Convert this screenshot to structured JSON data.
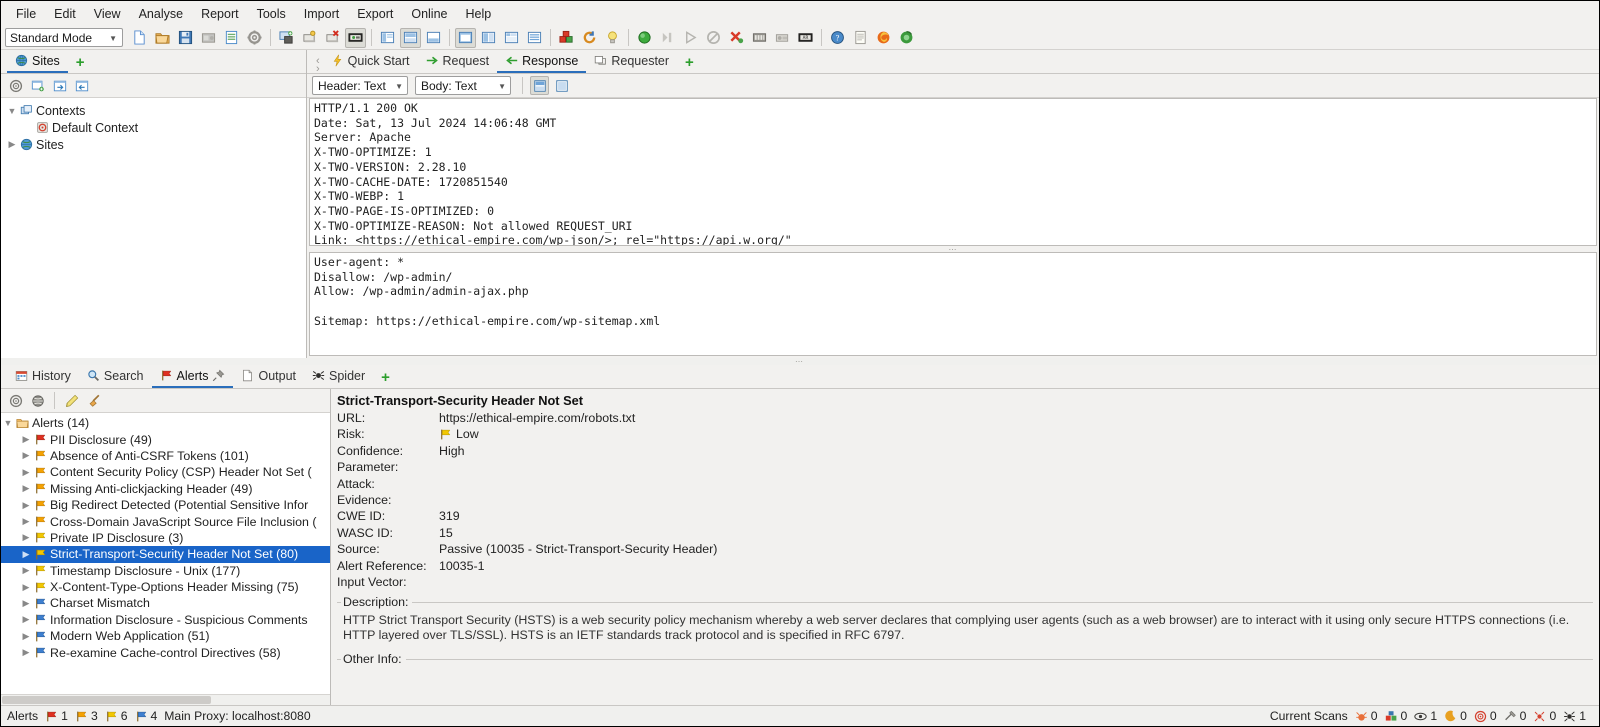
{
  "menubar": {
    "items": [
      "File",
      "Edit",
      "View",
      "Analyse",
      "Report",
      "Tools",
      "Import",
      "Export",
      "Online",
      "Help"
    ]
  },
  "toolbar": {
    "mode": "Standard Mode",
    "buttons": [
      {
        "name": "new-session-icon",
        "title": "New Session"
      },
      {
        "name": "open-session-icon",
        "title": "Open Session"
      },
      {
        "name": "save-session-icon",
        "title": "Persist Session"
      },
      {
        "name": "snapshot-session-icon",
        "title": "Snapshot Session"
      },
      {
        "name": "session-properties-icon",
        "title": "Session Properties"
      },
      {
        "name": "options-gear-icon",
        "title": "Options"
      },
      {
        "name": "manage-addons-icon",
        "title": "Manage Add-ons"
      },
      {
        "name": "expand-panel-icon",
        "title": "Expand"
      },
      {
        "name": "close-panel-icon",
        "title": "Close"
      },
      {
        "name": "full-layout-icon",
        "title": "Full Layout"
      },
      {
        "name": "layout-left-icon",
        "title": "Layout Left"
      },
      {
        "name": "layout-split-icon",
        "title": "Layout Split"
      },
      {
        "name": "layout-bottom-icon",
        "title": "Layout Bottom"
      },
      {
        "name": "layout-expand-icon",
        "title": "Expand Layout"
      },
      {
        "name": "layout-columns-icon",
        "title": "Columns Layout"
      },
      {
        "name": "layout-tabs-icon",
        "title": "Tabs Layout"
      },
      {
        "name": "layout-list-icon",
        "title": "List Layout"
      },
      {
        "name": "scan-policy-icon",
        "title": "Scan Policy Manager"
      },
      {
        "name": "refresh-icon",
        "title": "Refresh"
      },
      {
        "name": "lightbulb-icon",
        "title": "Show Tips"
      },
      {
        "name": "record-green-icon",
        "title": "Set Break"
      },
      {
        "name": "step-icon",
        "title": "Step"
      },
      {
        "name": "continue-icon",
        "title": "Continue"
      },
      {
        "name": "drop-icon",
        "title": "Drop"
      },
      {
        "name": "break-off-icon",
        "title": "Break Off"
      },
      {
        "name": "request-break-icon",
        "title": "Break on Request"
      },
      {
        "name": "response-break-icon",
        "title": "Break on Response"
      },
      {
        "name": "all-requests-icon",
        "title": "All Requests"
      },
      {
        "name": "help-circle-icon",
        "title": "Help"
      },
      {
        "name": "report-icon",
        "title": "Report"
      },
      {
        "name": "firefox-browser-icon",
        "title": "Launch Firefox"
      },
      {
        "name": "chrome-browser-icon",
        "title": "Launch Browser"
      }
    ]
  },
  "sites_panel": {
    "tab_label": "Sites",
    "tab_icon": "globe-icon",
    "add_tab_label": "+",
    "subtoolbar": [
      {
        "name": "target-scope-icon"
      },
      {
        "name": "new-window-icon"
      },
      {
        "name": "import-node-icon"
      },
      {
        "name": "export-node-icon"
      }
    ],
    "tree": [
      {
        "label": "Contexts",
        "icon": "contexts-icon",
        "expander": "expanded",
        "indent": 0
      },
      {
        "label": "Default Context",
        "icon": "default-context-icon",
        "expander": "none",
        "indent": 1
      },
      {
        "label": "Sites",
        "icon": "globe-icon",
        "expander": "collapsed",
        "indent": 0
      }
    ]
  },
  "request_panel": {
    "tabs": [
      {
        "label": "Quick Start",
        "icon": "lightning-icon",
        "active": false
      },
      {
        "label": "Request",
        "icon": "arrow-right-icon",
        "active": false
      },
      {
        "label": "Response",
        "icon": "arrow-left-icon",
        "active": true
      },
      {
        "label": "Requester",
        "icon": "requester-icon",
        "active": false
      }
    ],
    "add_tab_label": "+",
    "header_view": "Header: Text",
    "body_view": "Body: Text",
    "view_buttons": [
      {
        "name": "split-view-icon",
        "selected": true
      },
      {
        "name": "single-view-icon",
        "selected": false
      }
    ],
    "header_text": "HTTP/1.1 200 OK\nDate: Sat, 13 Jul 2024 14:06:48 GMT\nServer: Apache\nX-TWO-OPTIMIZE: 1\nX-TWO-VERSION: 2.28.10\nX-TWO-CACHE-DATE: 1720851540\nX-TWO-WEBP: 1\nX-TWO-PAGE-IS-OPTIMIZED: 0\nX-TWO-OPTIMIZE-REASON: Not allowed REQUEST_URI\nLink: <https://ethical-empire.com/wp-json/>; rel=\"https://api.w.org/\"",
    "body_text": "User-agent: *\nDisallow: /wp-admin/\nAllow: /wp-admin/admin-ajax.php\n\nSitemap: https://ethical-empire.com/wp-sitemap.xml"
  },
  "bottom_tabs": {
    "tabs": [
      {
        "label": "History",
        "icon": "history-icon",
        "active": false,
        "pinned": false
      },
      {
        "label": "Search",
        "icon": "search-icon",
        "active": false,
        "pinned": false
      },
      {
        "label": "Alerts",
        "icon": "flag-red-icon",
        "active": true,
        "pinned": true
      },
      {
        "label": "Output",
        "icon": "output-icon",
        "active": false,
        "pinned": false
      },
      {
        "label": "Spider",
        "icon": "spider-icon",
        "active": false,
        "pinned": false
      }
    ],
    "add_tab_label": "+"
  },
  "alerts_panel": {
    "subtoolbar": [
      {
        "name": "target-scope-icon"
      },
      {
        "name": "globe-gray-icon"
      },
      {
        "name": "edit-pencil-icon"
      },
      {
        "name": "broom-icon"
      }
    ],
    "root": {
      "label": "Alerts (14)",
      "icon": "folder-icon",
      "expander": "expanded"
    },
    "items": [
      {
        "label": "PII Disclosure (49)",
        "risk": "high",
        "selected": false
      },
      {
        "label": "Absence of Anti-CSRF Tokens (101)",
        "risk": "medium",
        "selected": false
      },
      {
        "label": "Content Security Policy (CSP) Header Not Set (",
        "risk": "medium",
        "selected": false
      },
      {
        "label": "Missing Anti-clickjacking Header (49)",
        "risk": "medium",
        "selected": false
      },
      {
        "label": "Big Redirect Detected (Potential Sensitive Infor",
        "risk": "medium",
        "selected": false
      },
      {
        "label": "Cross-Domain JavaScript Source File Inclusion (",
        "risk": "medium",
        "selected": false
      },
      {
        "label": "Private IP Disclosure (3)",
        "risk": "low",
        "selected": false
      },
      {
        "label": "Strict-Transport-Security Header Not Set (80)",
        "risk": "low",
        "selected": true
      },
      {
        "label": "Timestamp Disclosure - Unix (177)",
        "risk": "low",
        "selected": false
      },
      {
        "label": "X-Content-Type-Options Header Missing (75)",
        "risk": "low",
        "selected": false
      },
      {
        "label": "Charset Mismatch",
        "risk": "info",
        "selected": false
      },
      {
        "label": "Information Disclosure - Suspicious Comments",
        "risk": "info",
        "selected": false
      },
      {
        "label": "Modern Web Application (51)",
        "risk": "info",
        "selected": false
      },
      {
        "label": "Re-examine Cache-control Directives (58)",
        "risk": "info",
        "selected": false
      }
    ]
  },
  "alert_detail": {
    "title": "Strict-Transport-Security Header Not Set",
    "fields": [
      {
        "key": "URL:",
        "value": "https://ethical-empire.com/robots.txt",
        "icon": null
      },
      {
        "key": "Risk:",
        "value": "Low",
        "icon": "flag-low-icon"
      },
      {
        "key": "Confidence:",
        "value": "High",
        "icon": null
      },
      {
        "key": "Parameter:",
        "value": "",
        "icon": null
      },
      {
        "key": "Attack:",
        "value": "",
        "icon": null
      },
      {
        "key": "Evidence:",
        "value": "",
        "icon": null
      },
      {
        "key": "CWE ID:",
        "value": "319",
        "icon": null
      },
      {
        "key": "WASC ID:",
        "value": "15",
        "icon": null
      },
      {
        "key": "Source:",
        "value": "Passive (10035 - Strict-Transport-Security Header)",
        "icon": null
      },
      {
        "key": "Alert Reference:",
        "value": "10035-1",
        "icon": null
      },
      {
        "key": "Input Vector:",
        "value": "",
        "icon": null
      }
    ],
    "description_legend": "Description:",
    "description_text": "HTTP Strict Transport Security (HSTS) is a web security policy mechanism whereby a web server declares that complying user agents (such as a web browser) are to interact with it using only secure HTTPS connections (i.e. HTTP layered over TLS/SSL). HSTS is an IETF standards track protocol and is specified in RFC 6797.",
    "other_info_legend": "Other Info:",
    "other_info_text": ""
  },
  "statusbar": {
    "alerts_label": "Alerts",
    "alert_counts": [
      {
        "risk": "high",
        "count": "1"
      },
      {
        "risk": "medium",
        "count": "3"
      },
      {
        "risk": "low",
        "count": "6"
      },
      {
        "risk": "info",
        "count": "4"
      }
    ],
    "proxy_label": "Main Proxy: localhost:8080",
    "current_scans_label": "Current Scans",
    "scan_counts": [
      {
        "name": "spider-scan-icon",
        "count": "0"
      },
      {
        "name": "active-scan-icon",
        "count": "0"
      },
      {
        "name": "passive-scan-icon",
        "count": "1"
      },
      {
        "name": "ajax-spider-icon",
        "count": "0"
      },
      {
        "name": "fuzzer-icon",
        "count": "0"
      },
      {
        "name": "forced-browse-icon",
        "count": "0"
      },
      {
        "name": "websocket-icon",
        "count": "0"
      },
      {
        "name": "client-spider-icon",
        "count": "1"
      }
    ]
  },
  "colors": {
    "risk_high": "#e03020",
    "risk_medium": "#f5a201",
    "risk_low": "#f2c700",
    "risk_info": "#3d7fd0",
    "accent": "#2a6ebb",
    "selection": "#1964c8"
  }
}
